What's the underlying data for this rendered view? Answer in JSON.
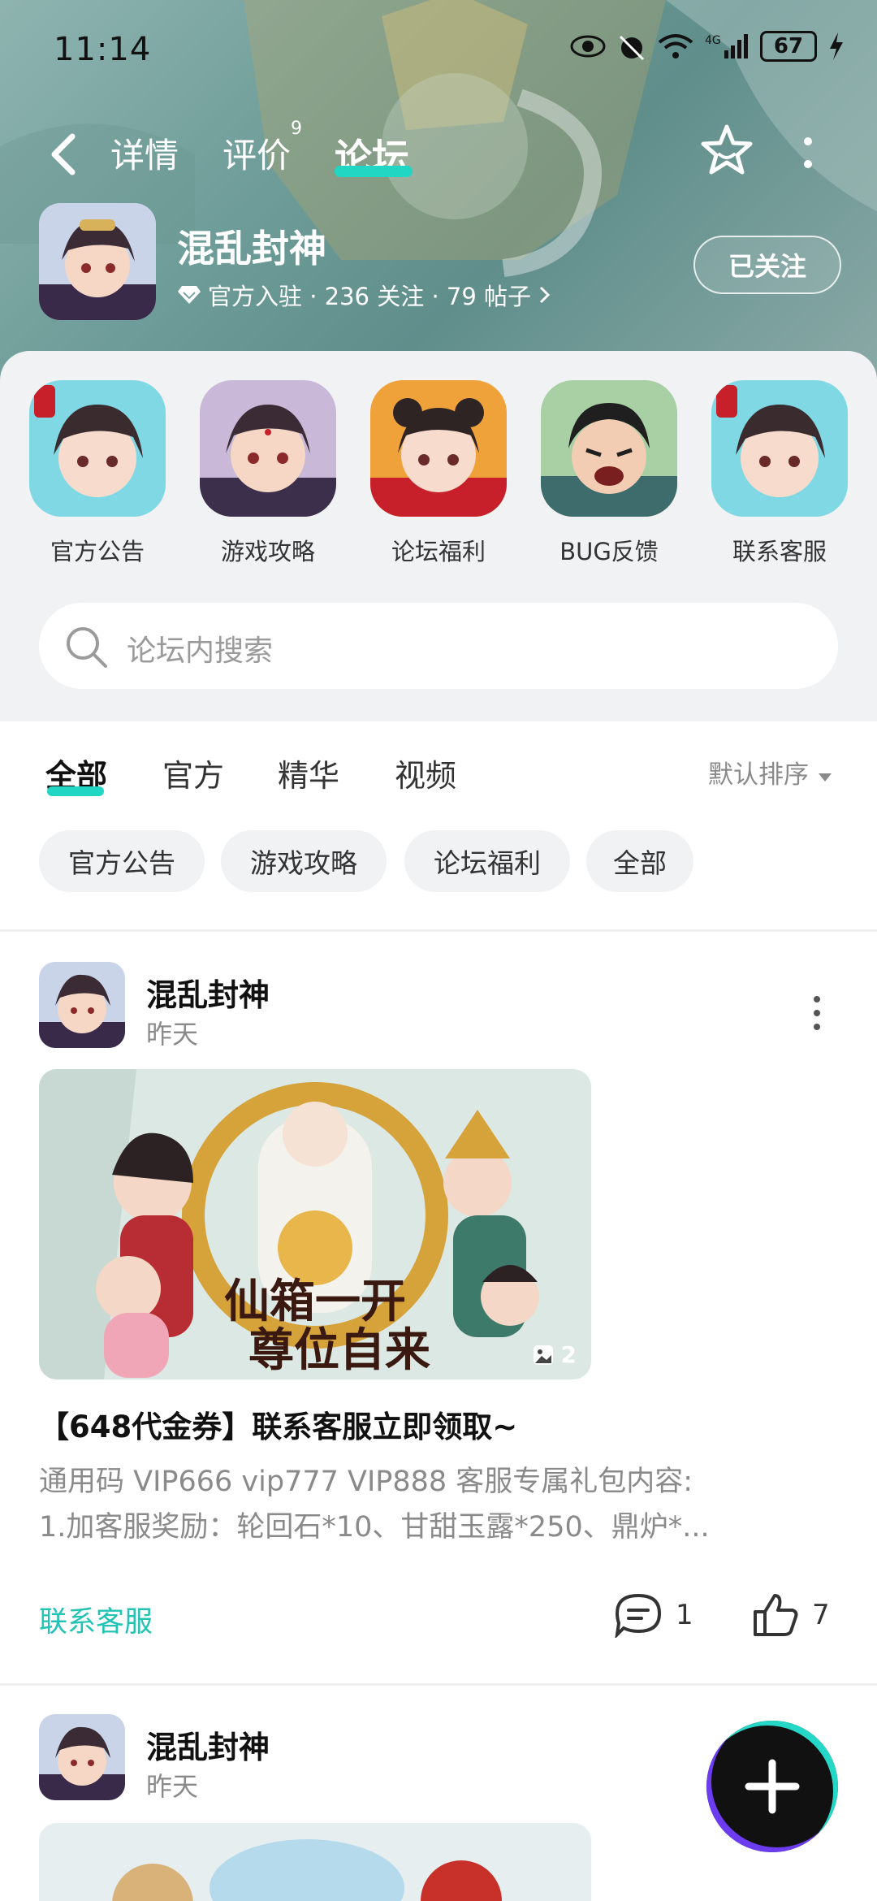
{
  "status_bar": {
    "time": "11:14",
    "battery": "67"
  },
  "nav": {
    "tabs": [
      {
        "label": "详情"
      },
      {
        "label": "评价",
        "badge": "9"
      },
      {
        "label": "论坛"
      }
    ],
    "active_tab": "论坛"
  },
  "game": {
    "title": "混乱封神",
    "meta": "官方入驻 · 236 关注 · 79 帖子",
    "follow_label": "已关注"
  },
  "categories": [
    {
      "label": "官方公告"
    },
    {
      "label": "游戏攻略"
    },
    {
      "label": "论坛福利"
    },
    {
      "label": "BUG反馈"
    },
    {
      "label": "联系客服"
    }
  ],
  "search": {
    "placeholder": "论坛内搜索"
  },
  "feed_tabs": [
    {
      "label": "全部"
    },
    {
      "label": "官方"
    },
    {
      "label": "精华"
    },
    {
      "label": "视频"
    }
  ],
  "sort_label": "默认排序",
  "filter_chips": [
    {
      "label": "官方公告"
    },
    {
      "label": "游戏攻略"
    },
    {
      "label": "论坛福利"
    },
    {
      "label": "全部"
    }
  ],
  "posts": [
    {
      "author": "混乱封神",
      "time": "昨天",
      "image_count": "2",
      "image_text_line1": "仙箱一开",
      "image_text_line2": "尊位自来",
      "title": "【648代金券】联系客服立即领取~",
      "body_line1": "通用码 VIP666 vip777 VIP888 客服专属礼包内容:",
      "body_line2": "1.加客服奖励：轮回石*10、甘甜玉露*250、鼎炉*...",
      "tag": "联系客服",
      "comments": "1",
      "likes": "7"
    },
    {
      "author": "混乱封神",
      "time": "昨天"
    }
  ],
  "colors": {
    "accent": "#22d6c4",
    "tag_text": "#22c3b3"
  }
}
